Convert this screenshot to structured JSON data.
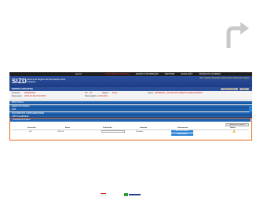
{
  "gov_bar": {
    "logo": "gov.br",
    "links": [
      "ACESSO À INFORMAÇÃO",
      "PARTICIPE",
      "LEGISLAÇÃO",
      "ÓRGÃOS DO GOVERNO"
    ],
    "highlight": "CORONAVÍRUS (COVID-19)"
  },
  "brand": {
    "logo": "SIZD",
    "subtitle": "Sistema de Registro de Informações sobre Imigração",
    "links": "Sair | Usuário  | Perguntas  | Fale conosco  | Manual do Usuário"
  },
  "title_bar": {
    "title": "EDITAR CADASTRO",
    "buttons": [
      "Imprimir formulário",
      "Enviar"
    ]
  },
  "info": {
    "protocol_label": "Protocolo:",
    "protocol_value": "PR00000000",
    "req_label": "Requerente:",
    "req_value": "JOSE DA SILVA SANTOS",
    "uf_label": "UF:",
    "uf_value": "SP",
    "cpf_label": "Origem:",
    "cpf_value": "Brasil",
    "date_label": "Data Cadastro:",
    "date_value": "19/01/2021",
    "status_label": "Status:",
    "status_value": "PENDENTE - ENVIAR DOCUMENTOS OBRIGATÓRIOS"
  },
  "sections": [
    "PROTOCOLO",
    "DADOS DO PEDIDO",
    "PAÍS",
    "DOCUMENTOS COMPLEMENTARES",
    "CRÍTICA EMPRESA"
  ],
  "documents": {
    "header": "Anexação de Arquivo",
    "add_button": "Adicionar Documento",
    "columns": [
      "Descrição",
      "Nome",
      "Publicação",
      "Situação",
      "Documentos",
      "Status"
    ],
    "row": {
      "num": "001",
      "name": "CNPJ Br",
      "situation": "Pendente",
      "btn_primary": "Selecionar Arquivo",
      "btn_secondary": "Enviar Arquivo"
    }
  },
  "colors": {
    "accent": "#1f63b3",
    "highlight_outline": "#e8661a",
    "alert": "#d62020"
  },
  "icons": [
    "share-arrow-icon",
    "warning-icon"
  ]
}
